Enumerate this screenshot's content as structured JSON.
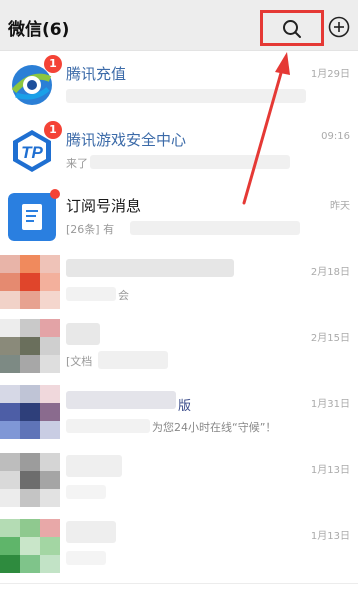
{
  "header": {
    "title": "微信(6)",
    "icons": [
      "search-icon",
      "add-icon"
    ]
  },
  "chats": [
    {
      "name": "腾讯充值",
      "badge": "1",
      "time": "1月29日",
      "preview": ""
    },
    {
      "name": "腾讯游戏安全中心",
      "badge": "1",
      "time": "09:16",
      "preview": "来了"
    },
    {
      "name": "订阅号消息",
      "badge": "",
      "time": "昨天",
      "preview": "[26条] 有"
    },
    {
      "name": "",
      "badge": "",
      "time": "2月18日",
      "preview": "会"
    },
    {
      "name": "",
      "badge": "",
      "time": "2月15日",
      "preview": "[文档"
    },
    {
      "name": "版",
      "badge": "",
      "time": "1月31日",
      "preview": "为您24小时在线“守候”！"
    },
    {
      "name": "",
      "badge": "",
      "time": "1月13日",
      "preview": ""
    },
    {
      "name": "",
      "badge": "",
      "time": "1月13日",
      "preview": ""
    }
  ],
  "colors": {
    "accent_red": "#e53935",
    "badge_red": "#f44336",
    "blue_text": "#3b6aa8"
  }
}
